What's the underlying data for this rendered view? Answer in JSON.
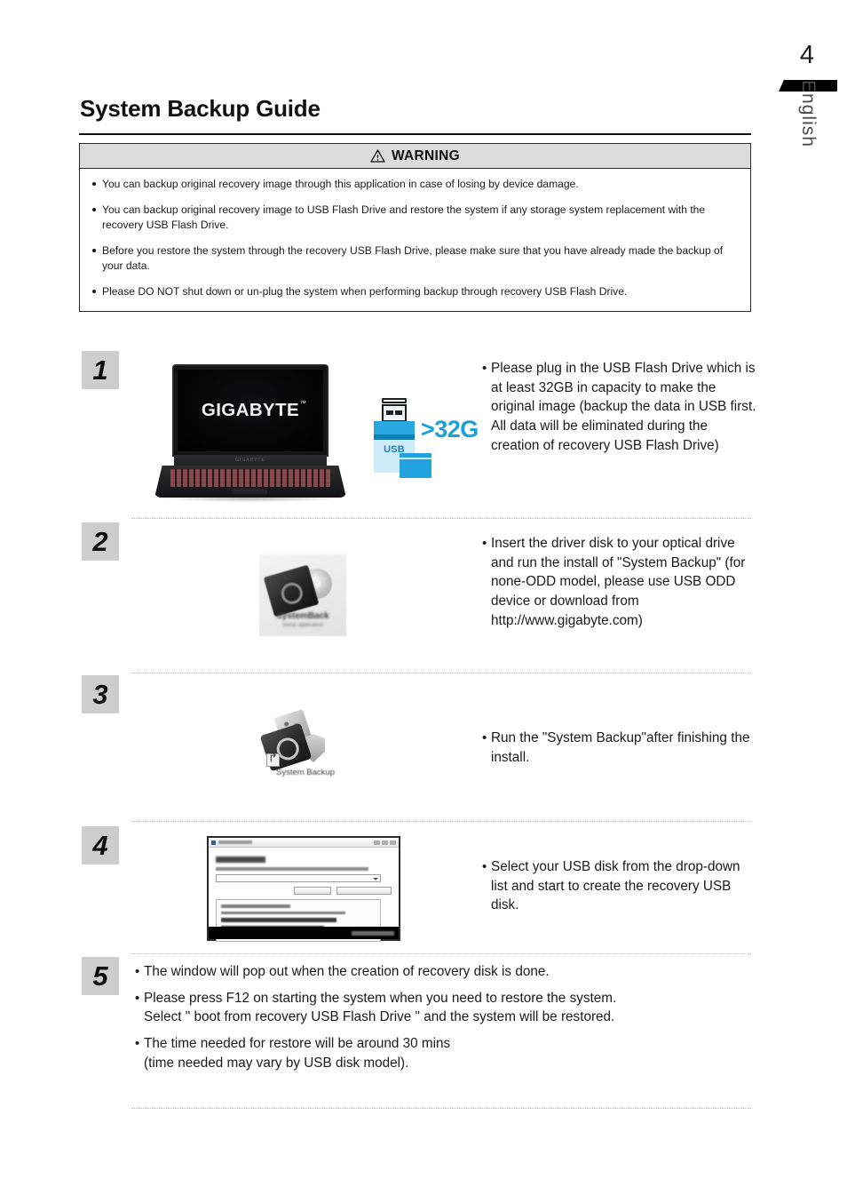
{
  "page": {
    "number": "4",
    "language_tab": "English",
    "title": "System Backup Guide"
  },
  "warning": {
    "heading": "WARNING",
    "icon": "warning-triangle-icon",
    "items": [
      "You can backup original recovery image through this application in case of losing by device damage.",
      "You can backup original recovery image to USB Flash Drive and restore the system if any storage system replacement with the recovery USB Flash Drive.",
      "Before you restore the system through the recovery USB Flash Drive, please make sure that you have already made the backup of your data.",
      "Please DO NOT shut down or un-plug the system when performing backup through recovery USB Flash Drive."
    ]
  },
  "steps": [
    {
      "number": "1",
      "illustration": "laptop-and-usb-drive",
      "laptop_logo": "GIGABYTE",
      "laptop_logo_tm": "™",
      "laptop_hinge_text": "GIGABYTE",
      "usb_label": "USB",
      "usb_capacity": ">32G",
      "bullets": [
        "Please plug in the USB Flash Drive which is at least 32GB in capacity to make the original image (backup the data in USB first. All data will be eliminated during the creation of recovery USB Flash Drive)"
      ]
    },
    {
      "number": "2",
      "illustration": "system-backup-installer-icon",
      "icon_caption": "SystemBack",
      "icon_subcaption": "Setup application",
      "bullets": [
        "Insert the driver disk to your optical drive and run the install of \"System Backup\" (for none-ODD model, please use USB ODD device or download from http://www.gigabyte.com)"
      ]
    },
    {
      "number": "3",
      "illustration": "system-backup-shortcut-icon",
      "icon_caption": "System Backup",
      "bullets": [
        "Run the \"System Backup\"after finishing the install."
      ]
    },
    {
      "number": "4",
      "illustration": "system-backup-app-window",
      "bullets": [
        "Select your USB disk from the drop-down list and start to create the recovery USB disk."
      ]
    },
    {
      "number": "5",
      "illustration": "none",
      "bullets": [
        "The window will pop out when the creation of recovery disk is done.",
        "Please press F12 on starting the system when you need to restore the system.\n Select \" boot from recovery USB Flash Drive \"  and the system will be restored.",
        "The time needed for restore will be around 30 mins\n(time needed may vary by USB disk model)."
      ]
    }
  ],
  "colors": {
    "usb_blue": "#22a3de",
    "usb_light_blue": "#cfeaf8",
    "number_box_gray": "#cdcdcd",
    "warning_header_gray": "#dcdcdc"
  }
}
